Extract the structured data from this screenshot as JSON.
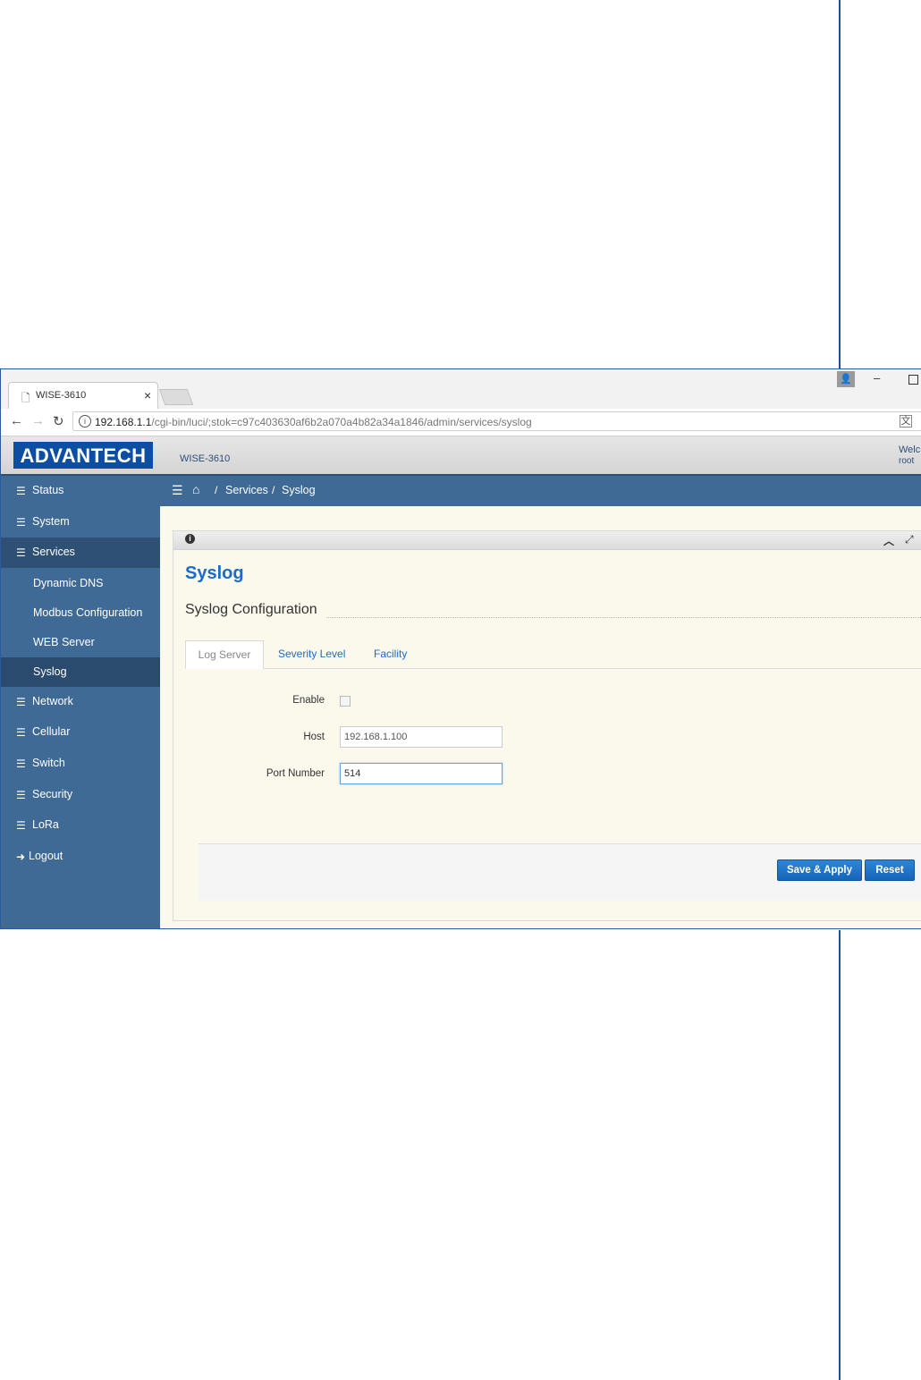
{
  "browser": {
    "tab_title": "WISE-3610",
    "tab_close": "×",
    "url_host": "192.168.1.1",
    "url_path": "/cgi-bin/luci/;stok=c97c403630af6b2a070a4b82a34a1846/admin/services/syslog"
  },
  "header": {
    "logo_text": "ADVANTECH",
    "model": "WISE-3610",
    "welcome": "Welc",
    "user": "root",
    "brand_color": "#0b4ea2"
  },
  "sidebar": {
    "items": [
      {
        "label": "Status"
      },
      {
        "label": "System"
      },
      {
        "label": "Services"
      },
      {
        "label": "Network"
      },
      {
        "label": "Cellular"
      },
      {
        "label": "Switch"
      },
      {
        "label": "Security"
      },
      {
        "label": "LoRa"
      },
      {
        "label": "Logout"
      }
    ],
    "sub_items": [
      {
        "label": "Dynamic DNS"
      },
      {
        "label": "Modbus Configuration"
      },
      {
        "label": "WEB Server"
      },
      {
        "label": "Syslog"
      }
    ],
    "color": "#3f6a95"
  },
  "breadcrumb": {
    "sep": "/",
    "items": [
      "Services",
      "Syslog"
    ]
  },
  "page": {
    "title": "Syslog",
    "section": "Syslog Configuration",
    "tabs": [
      "Log Server",
      "Severity Level",
      "Facility"
    ],
    "form": {
      "enable_label": "Enable",
      "host_label": "Host",
      "host_value": "192.168.1.100",
      "port_label": "Port Number",
      "port_value": "514"
    },
    "buttons": {
      "save_apply": "Save & Apply",
      "reset": "Reset"
    },
    "accent_color": "#1e6bc6"
  }
}
